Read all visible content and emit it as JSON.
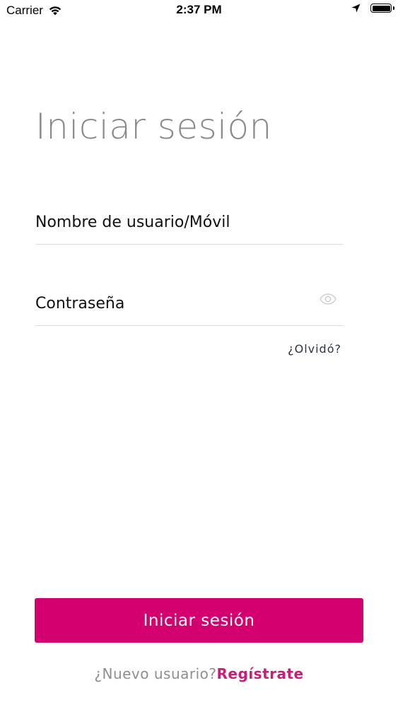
{
  "status_bar": {
    "carrier": "Carrier",
    "time": "2:37 PM",
    "icons": [
      "wifi-icon",
      "location-arrow-icon",
      "battery-icon"
    ]
  },
  "login": {
    "title": "Iniciar sesión",
    "username_placeholder": "Nombre de usuario/Móvil",
    "username_value": "",
    "password_placeholder": "Contraseña",
    "password_value": "",
    "password_toggle_icon": "eye-icon",
    "forgot_label": "¿Olvidó?",
    "submit_label": "Iniciar sesión",
    "new_user_label": "¿Nuevo usuario?",
    "register_label": "Regístrate"
  },
  "colors": {
    "accent": "#d4006f",
    "register_link": "#cc1c77",
    "title": "#8a8a8a",
    "divider": "#dcdcdc"
  }
}
